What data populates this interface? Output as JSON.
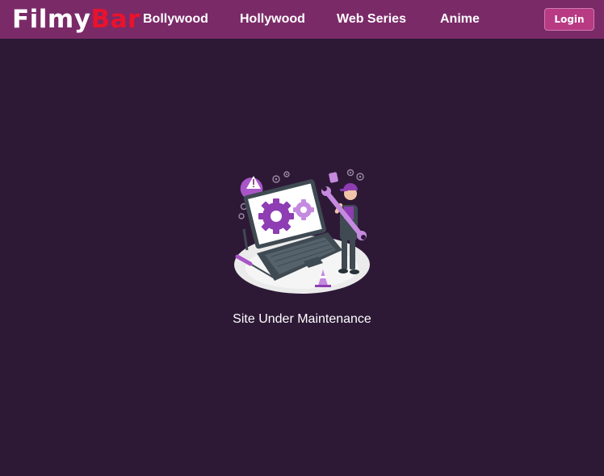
{
  "header": {
    "logo_part1": "Filmy",
    "logo_part2": "Bar",
    "nav": [
      "Bollywood",
      "Hollywood",
      "Web Series",
      "Anime"
    ],
    "login_label": "Login"
  },
  "main": {
    "illustration": "site-maintenance-illustration",
    "message": "Site Under Maintenance"
  },
  "colors": {
    "navbar_bg": "#7b2a68",
    "page_bg": "#2d1936",
    "logo_accent": "#e8132c",
    "login_button": "#b73a83"
  }
}
